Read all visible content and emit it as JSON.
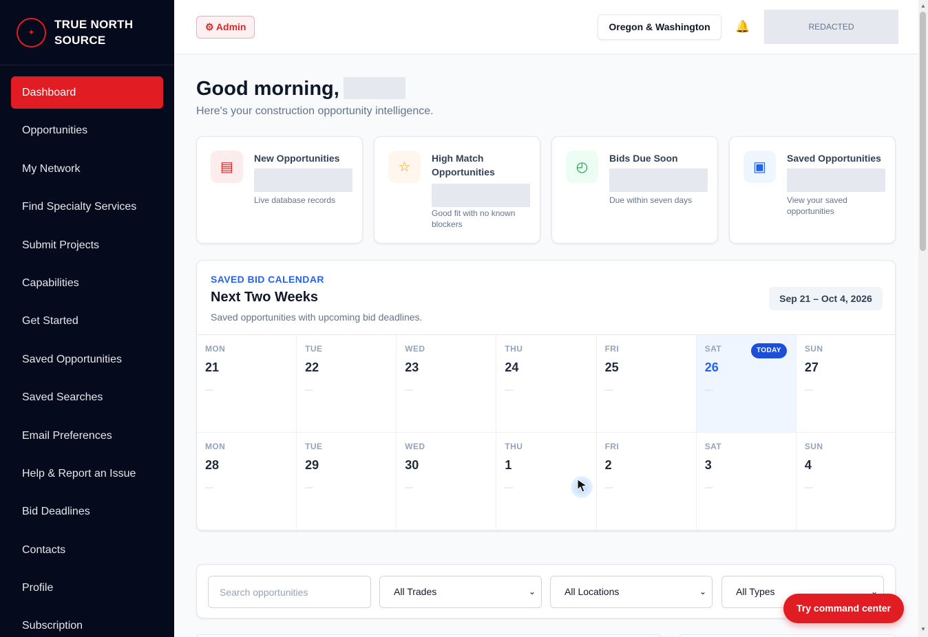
{
  "brand": {
    "name": "TRUE NORTH SOURCE",
    "logo_icon": "compass-star"
  },
  "sidebar": {
    "items": [
      {
        "label": "Dashboard",
        "active": true
      },
      {
        "label": "Opportunities"
      },
      {
        "label": "My Network"
      },
      {
        "label": "Find Specialty Services"
      },
      {
        "label": "Submit Projects"
      },
      {
        "label": "Capabilities"
      },
      {
        "label": "Get Started"
      },
      {
        "label": "Saved Opportunities"
      },
      {
        "label": "Saved Searches"
      },
      {
        "label": "Email Preferences"
      },
      {
        "label": "Help & Report an Issue"
      },
      {
        "label": "Bid Deadlines"
      },
      {
        "label": "Contacts"
      },
      {
        "label": "Profile"
      },
      {
        "label": "Subscription"
      }
    ]
  },
  "topbar": {
    "admin_label": "⚙ Admin",
    "region": "Oregon & Washington",
    "bell_icon": "bell",
    "user_placeholder": "REDACTED"
  },
  "greeting": {
    "title": "Good morning,",
    "subtitle": "Here's your construction opportunity intelligence."
  },
  "stats": [
    {
      "title": "New Opportunities",
      "sub": "Live database records",
      "icon": "document-list-icon",
      "glyph": "▤",
      "color": "#dc2626",
      "bg": "#fdecec"
    },
    {
      "title": "High Match Opportunities",
      "sub": "Good fit with no known blockers",
      "icon": "star-icon",
      "glyph": "☆",
      "color": "#f59e0b",
      "bg": "#fff7ed"
    },
    {
      "title": "Bids Due Soon",
      "sub": "Due within seven days",
      "icon": "clock-icon",
      "glyph": "◴",
      "color": "#16a34a",
      "bg": "#ecfdf3"
    },
    {
      "title": "Saved Opportunities",
      "sub": "View your saved opportunities",
      "icon": "bookmark-square-icon",
      "glyph": "▣",
      "color": "#2563eb",
      "bg": "#eff6ff"
    }
  ],
  "calendar": {
    "kicker": "SAVED BID CALENDAR",
    "title": "Next Two Weeks",
    "subtitle": "Saved opportunities with upcoming bid deadlines.",
    "range": "Sep 21 – Oct 4, 2026",
    "today_label": "TODAY",
    "days": [
      {
        "dow": "MON",
        "num": "21",
        "empty": "—"
      },
      {
        "dow": "TUE",
        "num": "22",
        "empty": "—"
      },
      {
        "dow": "WED",
        "num": "23",
        "empty": "—"
      },
      {
        "dow": "THU",
        "num": "24",
        "empty": "—"
      },
      {
        "dow": "FRI",
        "num": "25",
        "empty": "—"
      },
      {
        "dow": "SAT",
        "num": "26",
        "empty": "—",
        "today": true
      },
      {
        "dow": "SUN",
        "num": "27",
        "empty": "—"
      },
      {
        "dow": "MON",
        "num": "28",
        "empty": "—"
      },
      {
        "dow": "TUE",
        "num": "29",
        "empty": "—"
      },
      {
        "dow": "WED",
        "num": "30",
        "empty": "—"
      },
      {
        "dow": "THU",
        "num": "1",
        "empty": "—"
      },
      {
        "dow": "FRI",
        "num": "2",
        "empty": "—"
      },
      {
        "dow": "SAT",
        "num": "3",
        "empty": "—"
      },
      {
        "dow": "SUN",
        "num": "4",
        "empty": "—"
      }
    ]
  },
  "filters": {
    "search_placeholder": "Search opportunities",
    "trades": "All Trades",
    "locations": "All Locations",
    "types": "All Types"
  },
  "command_button": "Try command center"
}
